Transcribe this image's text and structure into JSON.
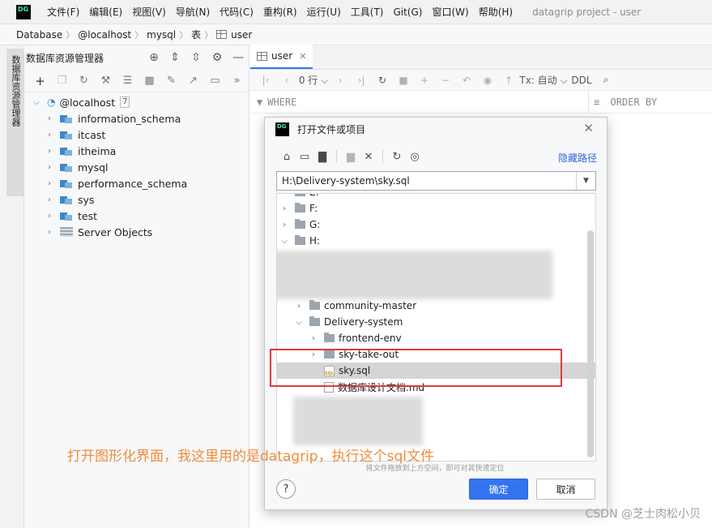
{
  "menubar": {
    "logo": "DG",
    "items": [
      "文件(F)",
      "编辑(E)",
      "视图(V)",
      "导航(N)",
      "代码(C)",
      "重构(R)",
      "运行(U)",
      "工具(T)",
      "Git(G)",
      "窗口(W)",
      "帮助(H)"
    ],
    "project_title": "datagrip project - user"
  },
  "breadcrumb": [
    "Database",
    "@localhost",
    "mysql",
    "表",
    "user"
  ],
  "left_strip": {
    "tab_label": "数据库资源管理器"
  },
  "explorer": {
    "title": "数据库资源管理器",
    "host": {
      "label": "@localhost",
      "count": "7"
    },
    "schemas": [
      "information_schema",
      "itcast",
      "itheima",
      "mysql",
      "performance_schema",
      "sys",
      "test"
    ],
    "server_objects": "Server Objects"
  },
  "editor": {
    "tab_label": "user",
    "rows_label": "0 行",
    "tx_label": "Tx: 自动",
    "ddl_label": "DDL",
    "where_label": "WHERE",
    "orderby_label": "ORDER BY"
  },
  "dialog": {
    "logo": "DG",
    "title": "打开文件或项目",
    "hide_path": "隐藏路径",
    "path_value": "H:\\Delivery-system\\sky.sql",
    "tree": {
      "drive_e": "E:",
      "drive_f": "F:",
      "drive_g": "G:",
      "drive_h": "H:",
      "community": "community-master",
      "delivery": "Delivery-system",
      "frontend": "frontend-env",
      "sky_take_out": "sky-take-out",
      "sky_sql": "sky.sql",
      "sky_sql_badge": "SQL",
      "db_doc": "数据库设计文档.md"
    },
    "hint": "将文件拖放到上方空间，即可对其快速定位",
    "ok_label": "确定",
    "cancel_label": "取消",
    "help_label": "?"
  },
  "annotation": "打开图形化界面，我这里用的是datagrip，执行这个sql文件",
  "watermark": "CSDN @芝士肉松小贝"
}
